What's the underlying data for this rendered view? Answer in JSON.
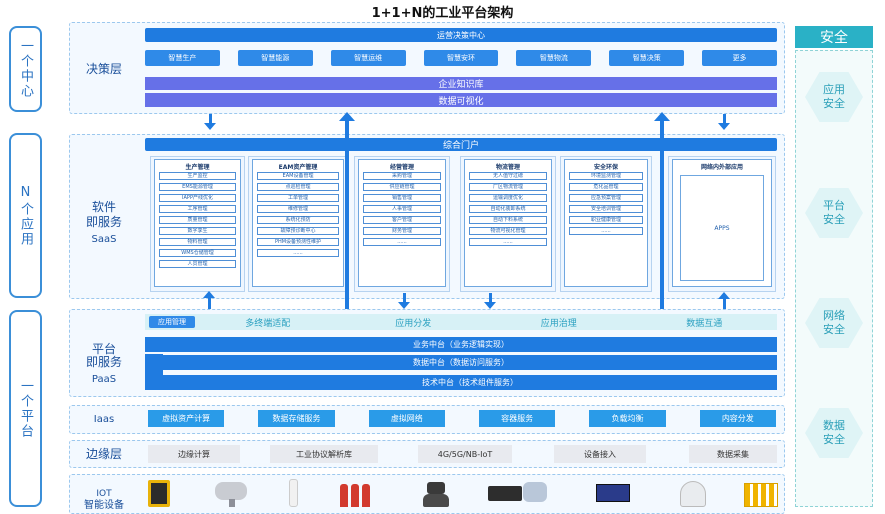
{
  "title": "1+1+N的工业平台架构",
  "left": {
    "one_center": "一个中心",
    "n_apps": "N个应用",
    "one_platform": "一个平台"
  },
  "layers": {
    "decision": "决策层",
    "saas_line1": "软件",
    "saas_line2": "即服务",
    "saas_line3": "SaaS",
    "paas_line1": "平台",
    "paas_line2": "即服务",
    "paas_line3": "PaaS",
    "iaas": "Iaas",
    "edge": "边缘层",
    "iot_line1": "IOT",
    "iot_line2": "智能设备"
  },
  "decision": {
    "center": "运营决策中心",
    "chips": [
      "智慧生产",
      "智慧能源",
      "智慧运维",
      "智慧安环",
      "智慧物流",
      "智慧决策",
      "更多"
    ],
    "knowledge": "企业知识库",
    "visualization": "数据可视化"
  },
  "saas": {
    "portal": "综合门户",
    "columns": [
      {
        "title": "生产管理",
        "items": [
          "生产监控",
          "EMS能源管理",
          "IAPP产线优化",
          "工序管理",
          "质量管理",
          "数字孪生",
          "物料管理",
          "WMS仓储管理",
          "人员管理"
        ]
      },
      {
        "title": "EAM资产管理",
        "items": [
          "EAM设备管理",
          "点巡检管理",
          "工单管理",
          "维修管理",
          "系统化预防",
          "故障预诊断中心",
          "PHM设备预测性维护",
          "......"
        ]
      },
      {
        "title": "经营管理",
        "items": [
          "采购管理",
          "供应链管理",
          "销售管理",
          "人事管理",
          "客户管理",
          "财务管理",
          "......"
        ]
      },
      {
        "title": "物流管理",
        "items": [
          "无人值守过磅",
          "厂区物流管理",
          "运输调度优化",
          "自动化装卸系统",
          "自动下料系统",
          "物流可视化管理",
          "......"
        ]
      },
      {
        "title": "安全环保",
        "items": [
          "环境监测管理",
          "危化品管理",
          "应急预案管理",
          "安全培训管理",
          "职业健康管理",
          "......"
        ]
      },
      {
        "title": "网络内外部应用",
        "items": [
          "APPS"
        ]
      }
    ]
  },
  "paas": {
    "small_chip": "应用管理",
    "light_labels": [
      "多终端适配",
      "应用分发",
      "应用治理",
      "数据互通"
    ],
    "business": "业务中台（业务逻辑实现）",
    "data": "数据中台（数据访问服务）",
    "tech": "技术中台（技术组件服务）"
  },
  "iaas": [
    "虚拟资产计算",
    "数据存储服务",
    "虚拟网络",
    "容器服务",
    "负载均衡",
    "内容分发"
  ],
  "edge": [
    "边缘计算",
    "工业协议解析库",
    "4G/5G/NB-IoT",
    "设备接入",
    "数据采集"
  ],
  "security": {
    "title": "安全",
    "items": [
      "应用\n安全",
      "平台\n安全",
      "网络\n安全",
      "数据\n安全"
    ]
  },
  "colors": {
    "primary_blue": "#1f7be0",
    "purple": "#6670e8",
    "cyan_light": "#d7f1f6",
    "security_teal": "#2ab1c6"
  }
}
